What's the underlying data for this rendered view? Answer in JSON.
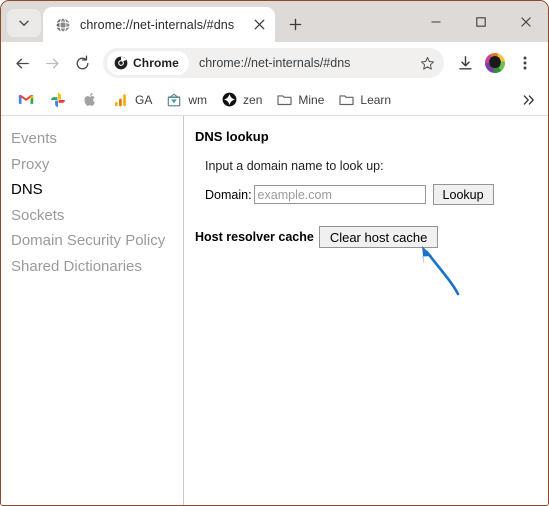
{
  "window": {
    "border_color": "#8a4b2a",
    "controls": {
      "minimize": "minimize-icon",
      "maximize": "maximize-icon",
      "close": "close-icon"
    }
  },
  "tabstrip": {
    "tab_search_icon": "chevron-down-icon",
    "new_tab_label": "+",
    "tabs": [
      {
        "title": "chrome://net-internals/#dns",
        "favicon": "globe-icon",
        "active": true,
        "close_icon": "close-icon"
      }
    ]
  },
  "toolbar": {
    "back_icon": "arrow-left-icon",
    "forward_icon": "arrow-right-icon",
    "reload_icon": "reload-icon",
    "chrome_chip_label": "Chrome",
    "chrome_chip_icon": "chrome-logo-icon",
    "url": "chrome://net-internals/#dns",
    "bookmark_star_icon": "star-icon",
    "download_icon": "download-icon",
    "profile_icon": "avatar-icon",
    "menu_icon": "three-dot-menu-icon"
  },
  "bookmarks": {
    "items": [
      {
        "label": "",
        "icon": "gmail-icon"
      },
      {
        "label": "",
        "icon": "google-photos-icon"
      },
      {
        "label": "",
        "icon": "apple-icon"
      },
      {
        "label": "GA",
        "icon": "google-analytics-icon"
      },
      {
        "label": "wm",
        "icon": "wm-site-icon"
      },
      {
        "label": "zen",
        "icon": "zen-icon"
      },
      {
        "label": "Mine",
        "icon": "folder-icon"
      },
      {
        "label": "Learn",
        "icon": "folder-icon"
      }
    ],
    "overflow_icon": "chevron-double-right-icon"
  },
  "sidebar": {
    "items": [
      {
        "label": "Events",
        "active": false
      },
      {
        "label": "Proxy",
        "active": false
      },
      {
        "label": "DNS",
        "active": true
      },
      {
        "label": "Sockets",
        "active": false
      },
      {
        "label": "Domain Security Policy",
        "active": false
      },
      {
        "label": "Shared Dictionaries",
        "active": false
      }
    ]
  },
  "content": {
    "section_title": "DNS lookup",
    "lookup_hint": "Input a domain name to look up:",
    "domain_label": "Domain:",
    "domain_value": "",
    "domain_placeholder": "example.com",
    "lookup_button": "Lookup",
    "cache_label": "Host resolver cache",
    "clear_cache_button": "Clear host cache",
    "annotation": {
      "type": "curved-arrow",
      "color": "#1a73c8",
      "points_to": "clear-host-cache-button"
    }
  }
}
